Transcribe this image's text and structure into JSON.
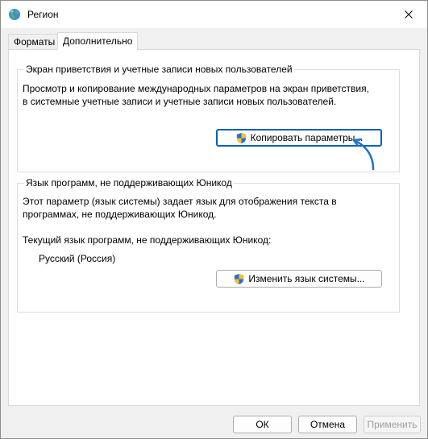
{
  "window": {
    "title": "Регион"
  },
  "tabs": [
    {
      "label": "Форматы",
      "active": false
    },
    {
      "label": "Дополнительно",
      "active": true
    }
  ],
  "welcome_group": {
    "legend": "Экран приветствия и учетные записи новых пользователей",
    "description_line1": "Просмотр и копирование международных параметров на экран приветствия,",
    "description_line2": "в системные учетные записи и учетные записи новых пользователей.",
    "button_label": "Копировать параметры..."
  },
  "nonunicode_group": {
    "legend": "Язык программ, не поддерживающих Юникод",
    "description_line1": "Этот параметр (язык системы) задает язык для отображения текста в",
    "description_line2": "программах, не поддерживающих Юникод.",
    "current_label": "Текущий язык программ, не поддерживающих Юникод:",
    "current_value": "Русский (Россия)",
    "button_label": "Изменить язык системы..."
  },
  "footer": {
    "ok_label": "ОК",
    "cancel_label": "Отмена",
    "apply_label": "Применить"
  },
  "colors": {
    "accent": "#005fb8",
    "annotation_arrow": "#1d73c9"
  }
}
